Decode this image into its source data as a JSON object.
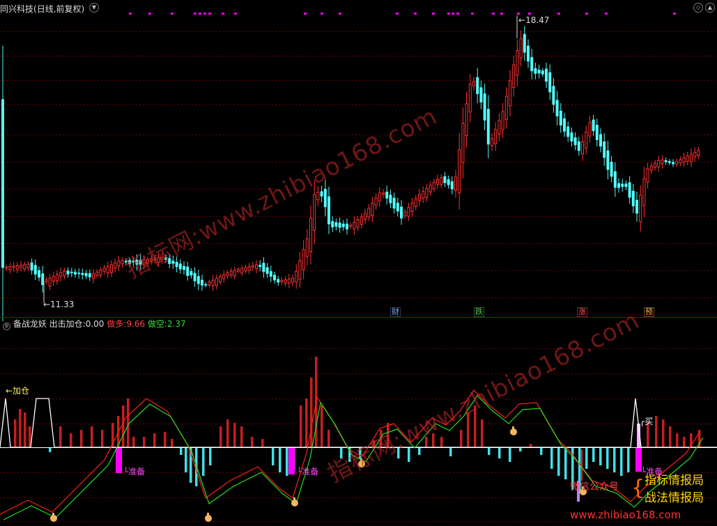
{
  "chart": {
    "title": "同兴科技",
    "period": "(日线,前复权)",
    "high_label": "18.47",
    "low_label": "11.33",
    "event_tags": [
      {
        "text": "财",
        "color": "#6ab4ff"
      },
      {
        "text": "跌",
        "color": "#44cc44"
      },
      {
        "text": "涨",
        "color": "#ff5555"
      },
      {
        "text": "预",
        "color": "#ffaa44"
      }
    ]
  },
  "indicator": {
    "name": "备战龙妖",
    "out_label": "出击加仓:",
    "out_value": "0.00",
    "long_label": "做多:",
    "long_value": "9.66",
    "short_label": "做空:",
    "short_value": "2.37",
    "add_label": "←加仓",
    "ready_label": "准备",
    "buy_label": "买"
  },
  "watermark": {
    "site": "www.zhibiao168.com",
    "brand_mid": "指标网:",
    "footer_site": "www.zhibiao168.com",
    "wechat": "微信公众号",
    "brand1": "指标情报局",
    "brand2": "战法情报局"
  },
  "colors": {
    "up": "#ff3232",
    "down": "#54fcfc",
    "hist_up": "#c81e1e",
    "hist_down": "#40e0e8",
    "magenta": "#ff00ff",
    "line_red": "#ff2020",
    "line_green": "#20e020"
  }
}
